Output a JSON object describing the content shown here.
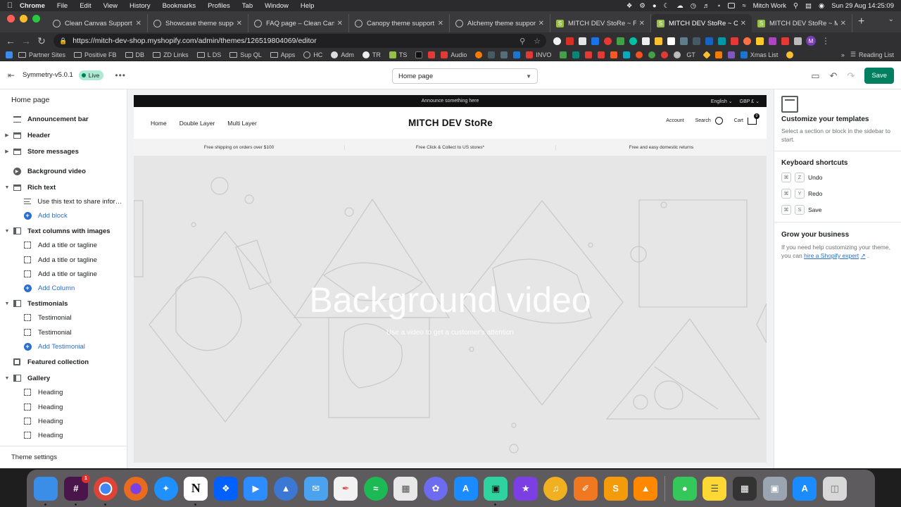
{
  "menubar": {
    "app_name": "Chrome",
    "menus": [
      "File",
      "Edit",
      "View",
      "History",
      "Bookmarks",
      "Profiles",
      "Tab",
      "Window",
      "Help"
    ],
    "user": "Mitch Work",
    "datetime": "Sun 29 Aug  14:25:09"
  },
  "tabs": [
    {
      "title": "Clean Canvas Support – S",
      "favicon": "globe-icon"
    },
    {
      "title": "Showcase theme support",
      "favicon": "globe-icon"
    },
    {
      "title": "FAQ page – Clean Canvas",
      "favicon": "globe-icon"
    },
    {
      "title": "Canopy theme support – C",
      "favicon": "globe-icon"
    },
    {
      "title": "Alchemy theme support –",
      "favicon": "globe-icon"
    },
    {
      "title": "MITCH DEV StoRe ~ FAQ",
      "favicon": "shopify-icon"
    },
    {
      "title": "MITCH DEV StoRe ~ Custo",
      "favicon": "shopify-icon",
      "active": true
    },
    {
      "title": "MITCH DEV StoRe ~ Main",
      "favicon": "shopify-icon"
    }
  ],
  "address_bar": {
    "url": "https://mitch-dev-shop.myshopify.com/admin/themes/126519804069/editor"
  },
  "bookmarks": [
    {
      "label": "Partner Sites",
      "type": "folder"
    },
    {
      "label": "Positive FB",
      "type": "folder"
    },
    {
      "label": "DB",
      "type": "folder"
    },
    {
      "label": "ZD Links",
      "type": "folder"
    },
    {
      "label": "L DS",
      "type": "folder"
    },
    {
      "label": "Sup QL",
      "type": "folder"
    },
    {
      "label": "Apps",
      "type": "folder"
    },
    {
      "label": "HC",
      "type": "link"
    },
    {
      "label": "Adm",
      "type": "link"
    },
    {
      "label": "TR",
      "type": "link"
    },
    {
      "label": "TS",
      "type": "link"
    },
    {
      "label": "Audio",
      "type": "link"
    },
    {
      "label": "INVO",
      "type": "link"
    },
    {
      "label": "GT",
      "type": "link"
    },
    {
      "label": "Xmas List",
      "type": "link"
    }
  ],
  "reading_list": "Reading List",
  "editor": {
    "theme_name": "Symmetry-v5.0.1",
    "live_badge": "Live",
    "page_select": "Home page",
    "save_label": "Save"
  },
  "sidebar": {
    "title": "Home page",
    "items": [
      {
        "label": "Announcement bar",
        "icon": "announcement-bar-icon",
        "level": 0
      },
      {
        "label": "Header",
        "icon": "header-icon",
        "level": 0,
        "collapsed": true
      },
      {
        "label": "Store messages",
        "icon": "store-messages-icon",
        "level": 0,
        "collapsed": true
      },
      {
        "label": "Background video",
        "icon": "video-icon",
        "level": 0
      },
      {
        "label": "Rich text",
        "icon": "rich-text-icon",
        "level": 0,
        "expanded": true
      },
      {
        "label": "Use this text to share informat...",
        "icon": "text-block-icon",
        "level": 1
      },
      {
        "label": "Add block",
        "icon": "add-icon",
        "level": 1,
        "add": true
      },
      {
        "label": "Text columns with images",
        "icon": "columns-icon",
        "level": 0,
        "expanded": true
      },
      {
        "label": "Add a title or tagline",
        "icon": "block-icon",
        "level": 1
      },
      {
        "label": "Add a title or tagline",
        "icon": "block-icon",
        "level": 1
      },
      {
        "label": "Add a title or tagline",
        "icon": "block-icon",
        "level": 1
      },
      {
        "label": "Add Column",
        "icon": "add-icon",
        "level": 1,
        "add": true
      },
      {
        "label": "Testimonials",
        "icon": "testimonials-icon",
        "level": 0,
        "expanded": true
      },
      {
        "label": "Testimonial",
        "icon": "block-icon",
        "level": 1
      },
      {
        "label": "Testimonial",
        "icon": "block-icon",
        "level": 1
      },
      {
        "label": "Add Testimonial",
        "icon": "add-icon",
        "level": 1,
        "add": true
      },
      {
        "label": "Featured collection",
        "icon": "collection-icon",
        "level": 0
      },
      {
        "label": "Gallery",
        "icon": "gallery-icon",
        "level": 0,
        "expanded": true
      },
      {
        "label": "Heading",
        "icon": "block-icon",
        "level": 1
      },
      {
        "label": "Heading",
        "icon": "block-icon",
        "level": 1
      },
      {
        "label": "Heading",
        "icon": "block-icon",
        "level": 1
      },
      {
        "label": "Heading",
        "icon": "block-icon",
        "level": 1
      }
    ],
    "theme_settings": "Theme settings"
  },
  "store": {
    "announcement": "Announce something here",
    "language": "English",
    "currency": "GBP £",
    "nav": [
      "Home",
      "Double Layer",
      "Multi Layer"
    ],
    "logo": "MITCH DEV StoRe",
    "account": "Account",
    "search": "Search",
    "cart": "Cart",
    "cart_count": "0",
    "messages": [
      "Free shipping on orders over $100",
      "Free Click & Collect to US stores*",
      "Free and easy domestic returns"
    ],
    "hero_title": "Background video",
    "hero_subtitle": "Use a video to get a customer's attention"
  },
  "right_panel": {
    "customize_title": "Customize your templates",
    "customize_text": "Select a section or block in the sidebar to start.",
    "shortcuts_title": "Keyboard shortcuts",
    "shortcuts": [
      {
        "mod": "⌘",
        "key": "Z",
        "label": "Undo"
      },
      {
        "mod": "⌘",
        "key": "Y",
        "label": "Redo"
      },
      {
        "mod": "⌘",
        "key": "S",
        "label": "Save"
      }
    ],
    "grow_title": "Grow your business",
    "grow_text": "If you need help customizing your theme, you can",
    "grow_link": "hire a Shopify expert",
    "grow_end": "."
  },
  "dock": [
    {
      "name": "finder-icon",
      "color": "#3b8ee8",
      "running": true
    },
    {
      "name": "slack-icon",
      "color": "#4a154b",
      "running": true,
      "badge": "1"
    },
    {
      "name": "chrome-icon",
      "color": "#e8e8e8",
      "running": true
    },
    {
      "name": "firefox-icon",
      "color": "#e86b20"
    },
    {
      "name": "safari-icon",
      "color": "#1e90ff"
    },
    {
      "name": "notion-icon",
      "color": "#ffffff",
      "running": true
    },
    {
      "name": "dropbox-icon",
      "color": "#0061fe"
    },
    {
      "name": "zoom-icon",
      "color": "#2d8cff"
    },
    {
      "name": "nav-icon",
      "color": "#3a78d4"
    },
    {
      "name": "mail-icon",
      "color": "#4ba3f0"
    },
    {
      "name": "pen-icon",
      "color": "#e05050"
    },
    {
      "name": "spotify-icon",
      "color": "#1db954"
    },
    {
      "name": "grid-app-icon",
      "color": "#e8e8e8"
    },
    {
      "name": "flower-app-icon",
      "color": "#6d6bf0"
    },
    {
      "name": "app-store-icon",
      "color": "#1a8cff"
    },
    {
      "name": "plug-app-icon",
      "color": "#2fd3a0",
      "running": true
    },
    {
      "name": "video-app-icon",
      "color": "#7b3fe4"
    },
    {
      "name": "audio-app-icon",
      "color": "#f0b020"
    },
    {
      "name": "paint-app-icon",
      "color": "#f07820"
    },
    {
      "name": "sublime-icon",
      "color": "#f49b0b"
    },
    {
      "name": "vlc-icon",
      "color": "#ff8800"
    },
    {
      "name": "messages-icon",
      "color": "#34c759"
    },
    {
      "name": "notes-icon",
      "color": "#fdd835"
    },
    {
      "name": "calculator-icon",
      "color": "#333333"
    },
    {
      "name": "preview-icon",
      "color": "#9aa5b1"
    },
    {
      "name": "app-store-2-icon",
      "color": "#1a8cff"
    },
    {
      "name": "trash-icon",
      "color": "#d8d8d8"
    }
  ]
}
